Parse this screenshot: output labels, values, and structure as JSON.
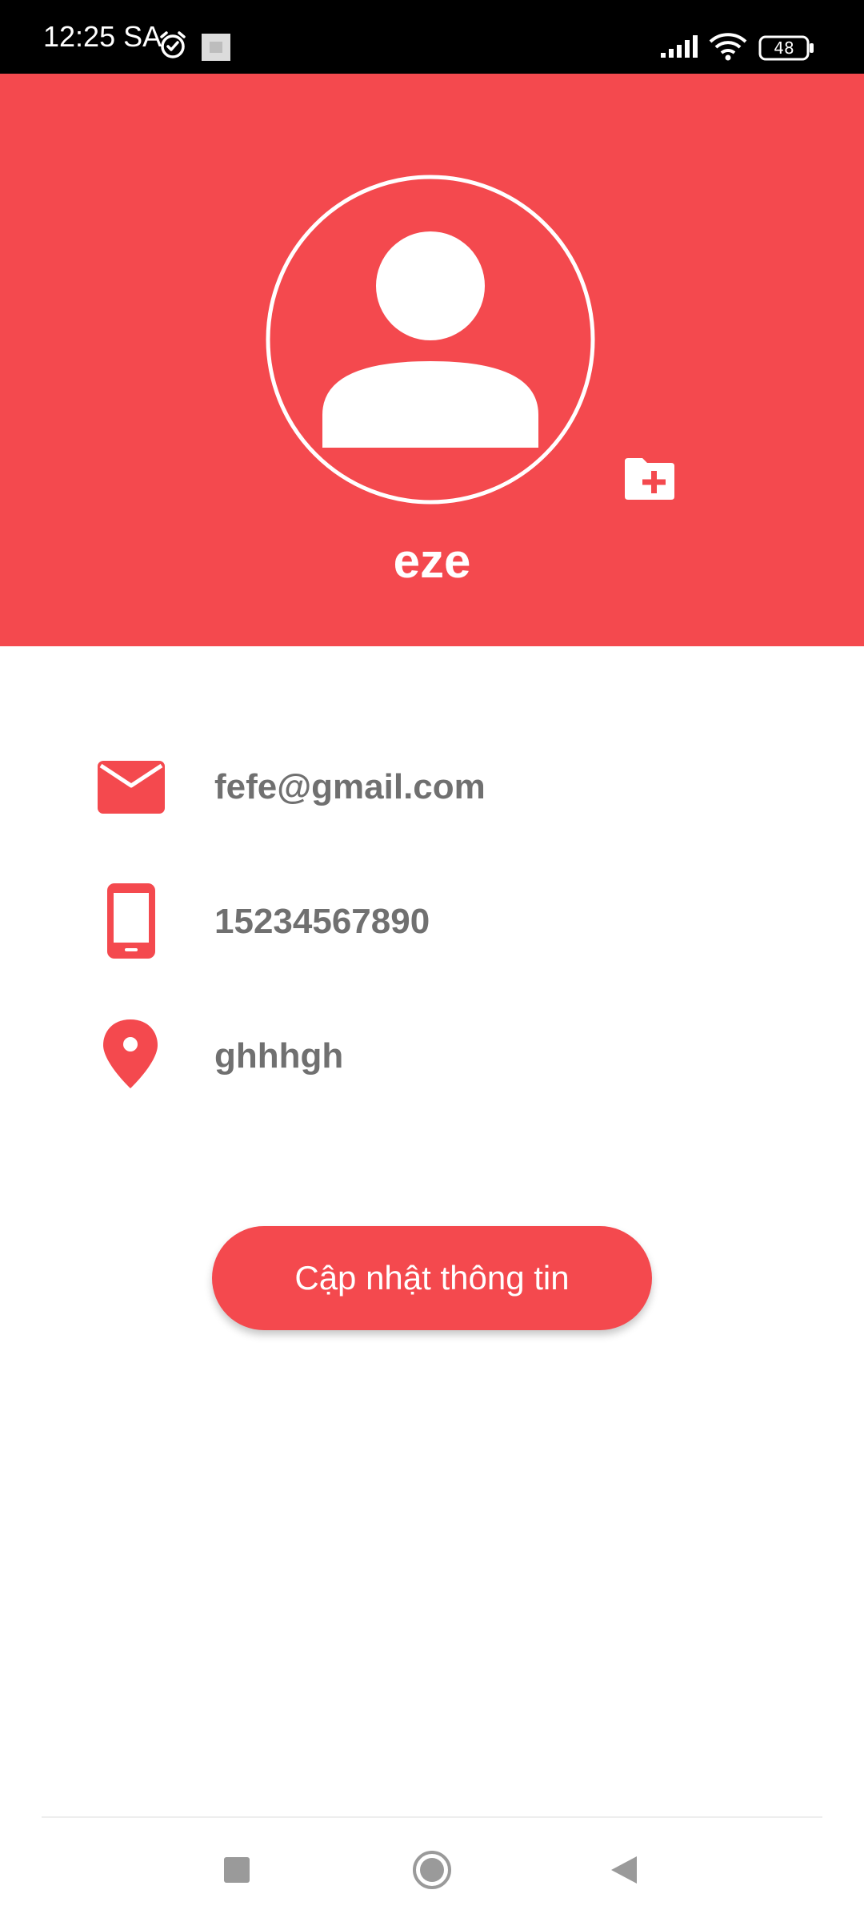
{
  "status_bar": {
    "time": "12:25 SA",
    "battery_level": "48"
  },
  "profile": {
    "username": "eze"
  },
  "info": {
    "email": "fefe@gmail.com",
    "phone": "15234567890",
    "address": "ghhhgh"
  },
  "actions": {
    "update_label": "Cập nhật thông tin"
  },
  "icons": {
    "alarm": "alarm-icon",
    "notification": "image-notification-icon",
    "signal": "signal-icon",
    "wifi": "wifi-icon",
    "battery": "battery-icon",
    "avatar": "person-avatar-icon",
    "add_photo": "folder-plus-icon",
    "email": "email-icon",
    "phone": "phone-icon",
    "address": "location-pin-icon",
    "nav_recent": "square-icon",
    "nav_home": "circle-icon",
    "nav_back": "triangle-back-icon"
  },
  "colors": {
    "accent": "#f4494e",
    "info_text": "#707070",
    "status_bar": "#000000"
  }
}
